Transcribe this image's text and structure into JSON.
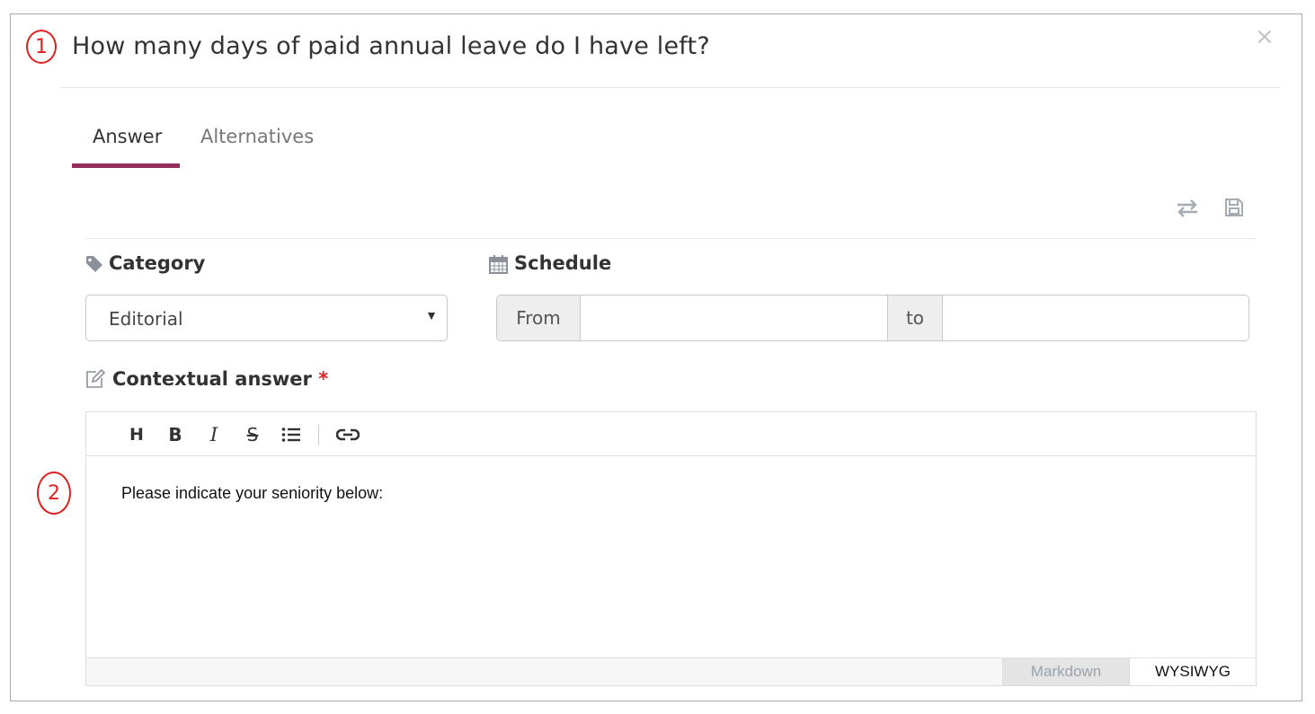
{
  "markers": [
    "1",
    "2"
  ],
  "dialog": {
    "title": "How many days of paid annual leave do I have left?",
    "close_icon": "close-icon",
    "close_glyph": "×"
  },
  "tabs": [
    {
      "label": "Answer",
      "active": true
    },
    {
      "label": "Alternatives",
      "active": false
    }
  ],
  "accent_color": "#932f5e",
  "toolbar_icons": [
    "swap-arrows-icon",
    "save-icon"
  ],
  "category": {
    "icon": "tag-icon",
    "label": "Category",
    "selected": "Editorial"
  },
  "schedule": {
    "icon": "calendar-icon",
    "label": "Schedule",
    "from_label": "From",
    "to_label": "to",
    "from_value": "",
    "to_value": ""
  },
  "contextual_answer": {
    "icon": "edit-icon",
    "label": "Contextual answer",
    "required_mark": "*",
    "toolbar": [
      {
        "name": "heading-icon",
        "glyph": "H"
      },
      {
        "name": "bold-icon",
        "glyph": "B"
      },
      {
        "name": "italic-icon",
        "glyph": "I"
      },
      {
        "name": "strikethrough-icon",
        "glyph": "S"
      },
      {
        "name": "bulleted-list-icon",
        "glyph": ""
      },
      {
        "name": "link-icon",
        "glyph": ""
      }
    ],
    "content": "Please indicate your seniority below:",
    "modes": [
      {
        "label": "Markdown",
        "active": false
      },
      {
        "label": "WYSIWYG",
        "active": true
      }
    ]
  }
}
